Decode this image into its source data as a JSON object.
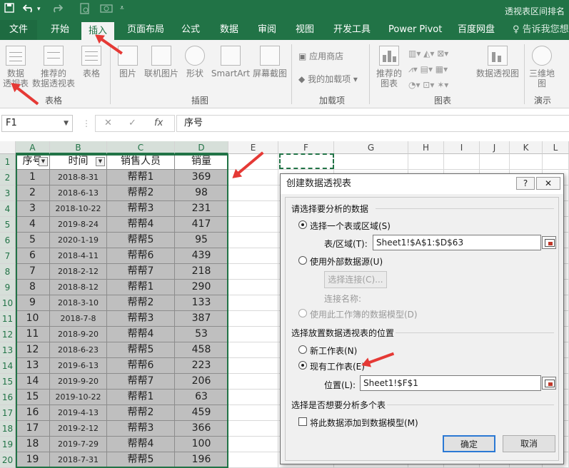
{
  "window": {
    "title": "透视表区间排名"
  },
  "quick_access": {
    "save_icon": "save-icon",
    "undo_icon": "undo-icon",
    "redo_icon": "redo-icon",
    "customize_icon": "customize-icon"
  },
  "tabs": [
    "文件",
    "开始",
    "插入",
    "页面布局",
    "公式",
    "数据",
    "审阅",
    "视图",
    "开发工具",
    "Power Pivot",
    "百度网盘"
  ],
  "active_tab": "插入",
  "tell_me": "告诉我您想要",
  "ribbon": {
    "pivot_label": "数据\n透视表",
    "recommended_pivot_label": "推荐的\n数据透视表",
    "table_label": "表格",
    "group_tables": "表格",
    "picture_label": "图片",
    "online_picture_label": "联机图片",
    "shapes_label": "形状",
    "smartart_label": "SmartArt",
    "screenshot_label": "屏幕截图",
    "group_illustrations": "插图",
    "store_label": "应用商店",
    "my_addins_label": "我的加载项",
    "group_addins": "加载项",
    "recommended_charts_label": "推荐的\n图表",
    "pivot_chart_label": "数据透视图",
    "group_charts": "图表",
    "map3d_label": "三维地\n图",
    "group_tours": "演示"
  },
  "formula_bar": {
    "name_box": "F1",
    "cancel": "✕",
    "enter": "✓",
    "fx": "fx",
    "formula": "序号"
  },
  "columns": [
    "A",
    "B",
    "C",
    "D",
    "E",
    "F",
    "G",
    "H",
    "I",
    "J",
    "K",
    "L"
  ],
  "table": {
    "headers": [
      "序号",
      "时间",
      "销售人员",
      "销量"
    ],
    "rows": [
      [
        "1",
        "2018-8-31",
        "帮帮1",
        "369"
      ],
      [
        "2",
        "2018-6-13",
        "帮帮2",
        "98"
      ],
      [
        "3",
        "2018-10-22",
        "帮帮3",
        "231"
      ],
      [
        "4",
        "2019-8-24",
        "帮帮4",
        "417"
      ],
      [
        "5",
        "2020-1-19",
        "帮帮5",
        "95"
      ],
      [
        "6",
        "2018-4-11",
        "帮帮6",
        "439"
      ],
      [
        "7",
        "2018-2-12",
        "帮帮7",
        "218"
      ],
      [
        "8",
        "2018-8-12",
        "帮帮1",
        "290"
      ],
      [
        "9",
        "2018-3-10",
        "帮帮2",
        "133"
      ],
      [
        "10",
        "2018-7-8",
        "帮帮3",
        "387"
      ],
      [
        "11",
        "2018-9-20",
        "帮帮4",
        "53"
      ],
      [
        "12",
        "2018-6-23",
        "帮帮5",
        "458"
      ],
      [
        "13",
        "2019-6-13",
        "帮帮6",
        "223"
      ],
      [
        "14",
        "2019-9-20",
        "帮帮7",
        "206"
      ],
      [
        "15",
        "2019-10-22",
        "帮帮1",
        "63"
      ],
      [
        "16",
        "2019-4-13",
        "帮帮2",
        "459"
      ],
      [
        "17",
        "2019-2-12",
        "帮帮3",
        "366"
      ],
      [
        "18",
        "2019-7-29",
        "帮帮4",
        "100"
      ],
      [
        "19",
        "2018-7-31",
        "帮帮5",
        "196"
      ]
    ]
  },
  "dialog": {
    "title": "创建数据透视表",
    "help": "?",
    "close": "✕",
    "section_data": "请选择要分析的数据",
    "opt_range": "选择一个表或区域(S)",
    "range_label": "表/区域(T):",
    "range_value": "Sheet1!$A$1:$D$63",
    "opt_external": "使用外部数据源(U)",
    "choose_conn": "选择连接(C)...",
    "conn_name": "连接名称:",
    "opt_model": "使用此工作簿的数据模型(D)",
    "section_location": "选择放置数据透视表的位置",
    "opt_new_sheet": "新工作表(N)",
    "opt_existing_sheet": "现有工作表(E)",
    "location_label": "位置(L):",
    "location_value": "Sheet1!$F$1",
    "section_multi": "选择是否想要分析多个表",
    "add_to_model": "将此数据添加到数据模型(M)",
    "ok": "确定",
    "cancel": "取消"
  }
}
